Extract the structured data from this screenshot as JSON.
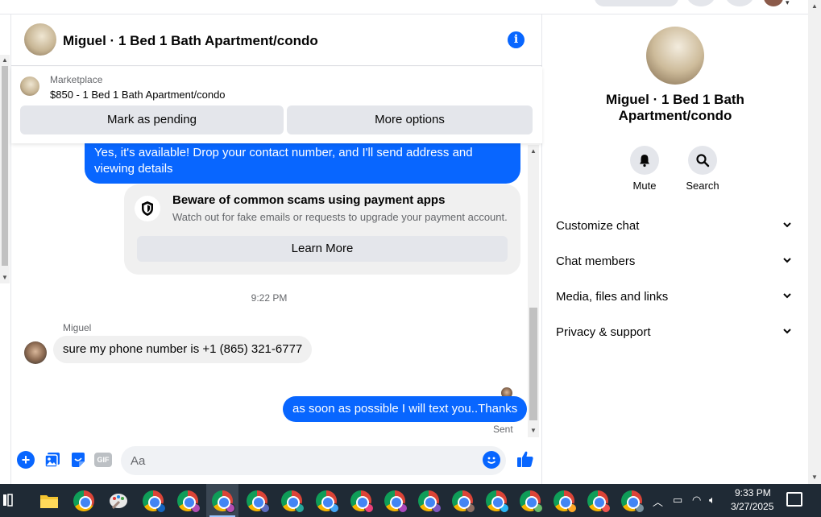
{
  "header": {
    "title": "Miguel · 1 Bed 1 Bath Apartment/condo"
  },
  "marketplace": {
    "source": "Marketplace",
    "listing": "$850 - 1 Bed 1 Bath Apartment/condo",
    "mark_pending_label": "Mark as pending",
    "more_options_label": "More options"
  },
  "messages": {
    "outgoing_1": "Yes, it's available! Drop your contact number, and I'll send address and viewing details",
    "scam_title": "Beware of common scams using payment apps",
    "scam_subtitle": "Watch out for fake emails or requests to upgrade your payment account.",
    "learn_more_label": "Learn More",
    "timestamp": "9:22 PM",
    "sender_name": "Miguel",
    "incoming_1": "sure my phone number is +1 (865) 321-6777",
    "outgoing_2": "as soon as possible I will text you..Thanks",
    "status": "Sent"
  },
  "composer": {
    "placeholder": "Aa",
    "gif_label": "GIF"
  },
  "details": {
    "title": "Miguel · 1 Bed 1 Bath Apartment/condo",
    "actions": [
      {
        "label": "Mute",
        "icon": "bell-icon"
      },
      {
        "label": "Search",
        "icon": "search-icon"
      }
    ],
    "sections": [
      "Customize chat",
      "Chat members",
      "Media, files and links",
      "Privacy & support"
    ]
  },
  "taskbar": {
    "time": "9:33 PM",
    "date": "3/27/2025"
  },
  "colors": {
    "accent": "#0866ff",
    "bubble_in": "#f0f0f0",
    "taskbar": "#1f2a35"
  }
}
